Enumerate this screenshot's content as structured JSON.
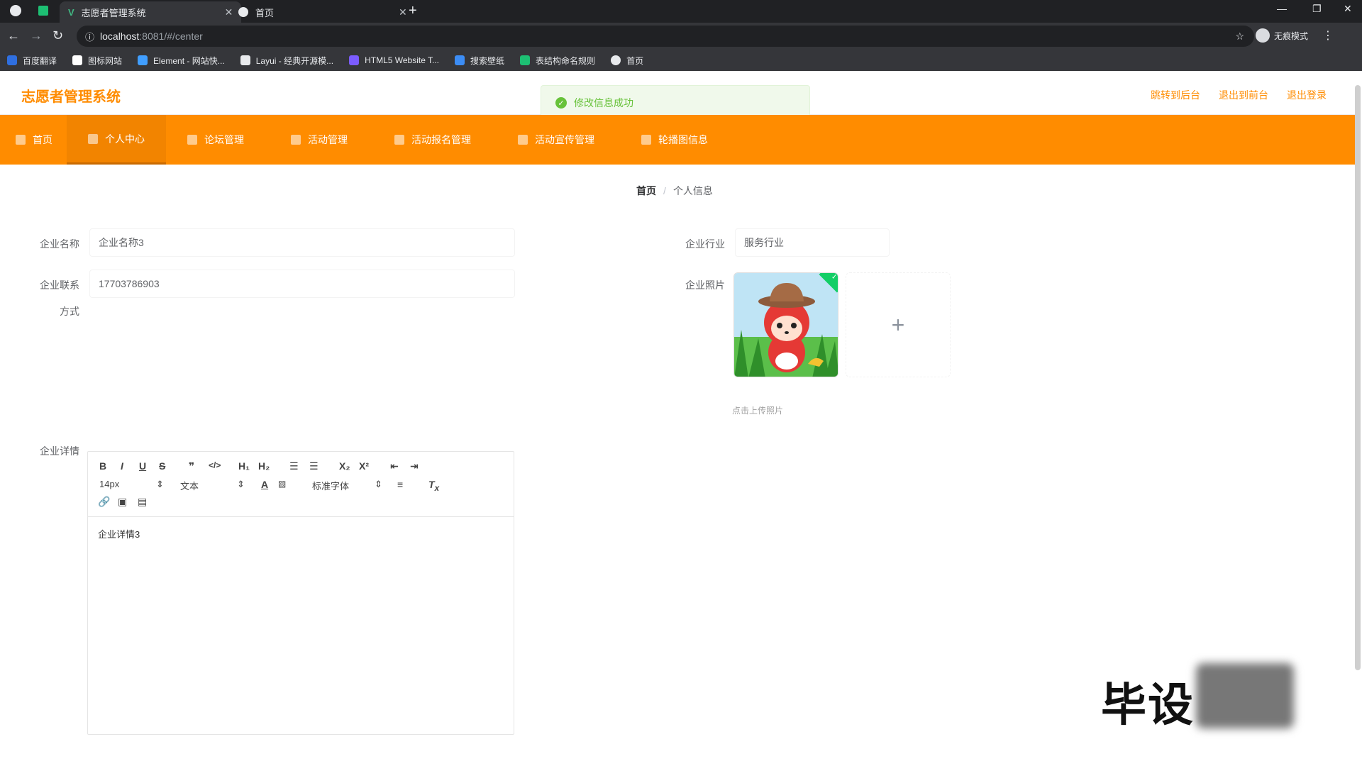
{
  "browser": {
    "tabs": [
      {
        "title": "志愿者管理系统",
        "active": true
      },
      {
        "title": "首页",
        "active": false
      }
    ],
    "url_host": "localhost",
    "url_rest": ":8081/#/center",
    "profile_label": "无痕模式",
    "bookmarks": [
      {
        "label": "百度翻译",
        "color": "#2f6fe0"
      },
      {
        "label": "图标网站",
        "color": "#ffffff"
      },
      {
        "label": "Element - 网站快...",
        "color": "#409eff"
      },
      {
        "label": "Layui - 经典开源模...",
        "color": "#e8eaed"
      },
      {
        "label": "HTML5 Website T...",
        "color": "#7b5cff"
      },
      {
        "label": "搜索壁纸",
        "color": "#3c8df5"
      },
      {
        "label": "表结构命名规则",
        "color": "#1dbf73"
      },
      {
        "label": "首页",
        "color": "#e8eaed"
      }
    ]
  },
  "app": {
    "brand": "志愿者管理系统",
    "header_links": [
      "跳转到后台",
      "退出到前台",
      "退出登录"
    ],
    "toast": "修改信息成功",
    "nav": [
      "首页",
      "个人中心",
      "论坛管理",
      "活动管理",
      "活动报名管理",
      "活动宣传管理",
      "轮播图信息"
    ],
    "breadcrumb": {
      "home": "首页",
      "current": "个人信息"
    },
    "form": {
      "company_name_label": "企业名称",
      "company_name_value": "企业名称3",
      "industry_label": "企业行业",
      "industry_value": "服务行业",
      "contact_label_1": "企业联系",
      "contact_label_2": "方式",
      "contact_value": "17703786903",
      "photo_label": "企业照片",
      "photo_tip": "点击上传照片",
      "detail_label": "企业详情",
      "detail_value": "企业详情3"
    },
    "editor_toolbar": {
      "font_size": "14px",
      "text_style": "文本",
      "font_family": "标准字体"
    },
    "watermark": "毕设"
  },
  "colors": {
    "accent": "#ff8c00",
    "success": "#67c23a"
  }
}
